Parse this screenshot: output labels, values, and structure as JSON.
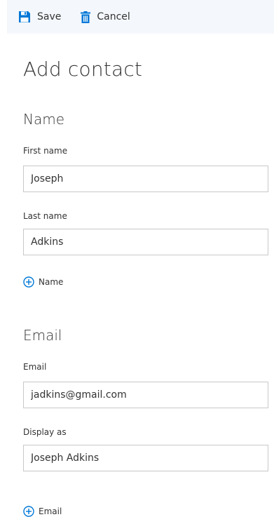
{
  "toolbar": {
    "save_label": "Save",
    "cancel_label": "Cancel"
  },
  "page_title": "Add contact",
  "name_section": {
    "title": "Name",
    "first_name_label": "First name",
    "first_name_value": "Joseph",
    "last_name_label": "Last name",
    "last_name_value": "Adkins",
    "add_link_label": "Name"
  },
  "email_section": {
    "title": "Email",
    "email_label": "Email",
    "email_value": "jadkins@gmail.com",
    "display_as_label": "Display as",
    "display_as_value": "Joseph Adkins",
    "add_link_label": "Email"
  },
  "icons": {
    "save": "floppy-disk-icon",
    "cancel": "trash-icon",
    "add": "plus-circle-icon"
  },
  "colors": {
    "accent": "#0078d7",
    "toolbar_bg": "#f4f7fb",
    "input_border": "#c8c8c8",
    "text": "#333333"
  }
}
